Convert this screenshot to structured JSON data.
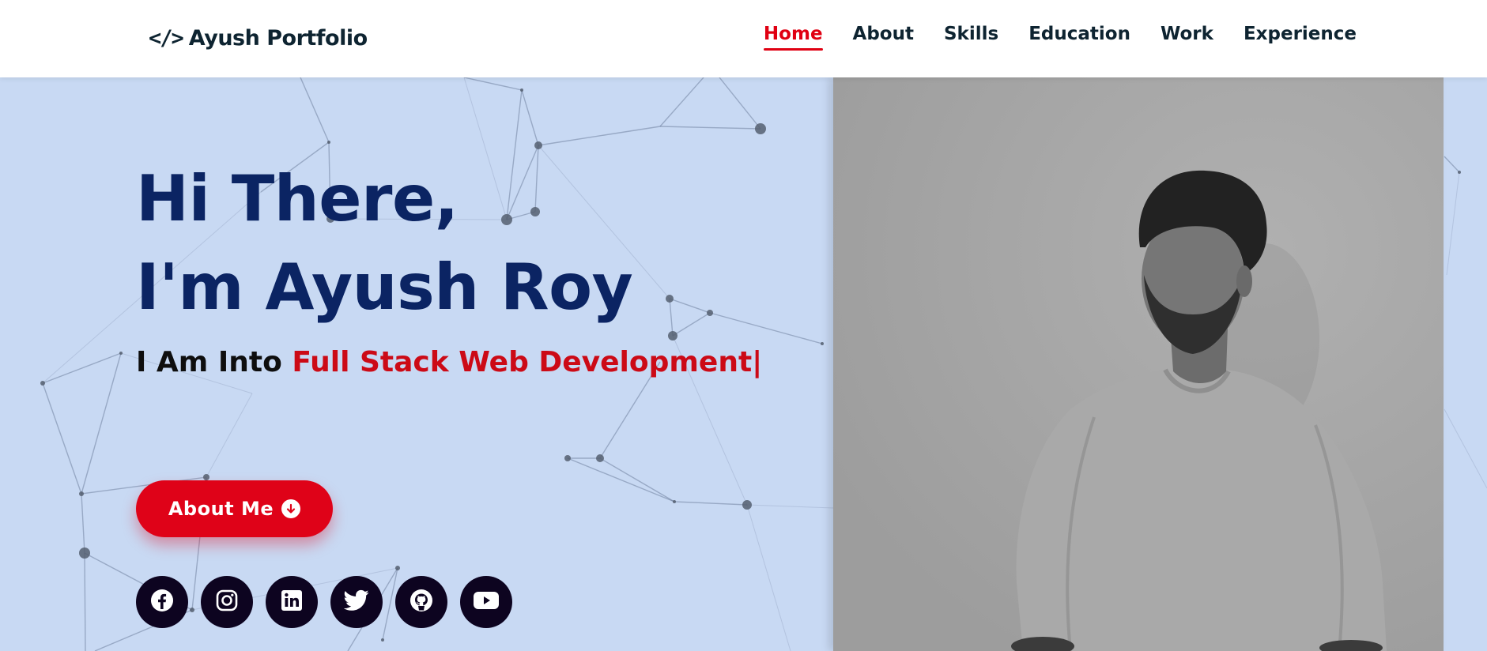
{
  "brand": {
    "icon": "code-icon",
    "icon_glyph": "</>",
    "name": "Ayush Portfolio"
  },
  "nav": {
    "items": [
      {
        "label": "Home",
        "active": true
      },
      {
        "label": "About",
        "active": false
      },
      {
        "label": "Skills",
        "active": false
      },
      {
        "label": "Education",
        "active": false
      },
      {
        "label": "Work",
        "active": false
      },
      {
        "label": "Experience",
        "active": false
      }
    ]
  },
  "hero": {
    "greeting_line1": "Hi There,",
    "greeting_line2": "I'm Ayush Roy",
    "typing_prefix": "I Am Into ",
    "typing_text": "Full Stack Web Development",
    "typing_caret": "|",
    "cta_label": "About Me",
    "cta_icon": "arrow-down-circle-icon",
    "socials": [
      {
        "name": "facebook-icon"
      },
      {
        "name": "instagram-icon"
      },
      {
        "name": "linkedin-icon"
      },
      {
        "name": "twitter-icon"
      },
      {
        "name": "github-icon"
      },
      {
        "name": "youtube-icon"
      }
    ]
  },
  "colors": {
    "background": "#c8d9f3",
    "navbar": "#ffffff",
    "heading": "#0b2463",
    "accent": "#e00012",
    "social_bg": "#0d0420",
    "photo_bg": "#a7a7a7"
  }
}
